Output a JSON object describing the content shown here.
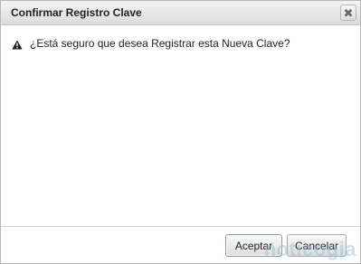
{
  "dialog": {
    "title": "Confirmar Registro Clave",
    "close_icon": "close-icon"
  },
  "content": {
    "icon": "warning-icon",
    "message": "¿Está seguro que desea Registrar esta Nueva Clave?"
  },
  "footer": {
    "accept_label": "Aceptar",
    "cancel_label": "Cancelar"
  },
  "watermark": {
    "text": "noticogia"
  }
}
